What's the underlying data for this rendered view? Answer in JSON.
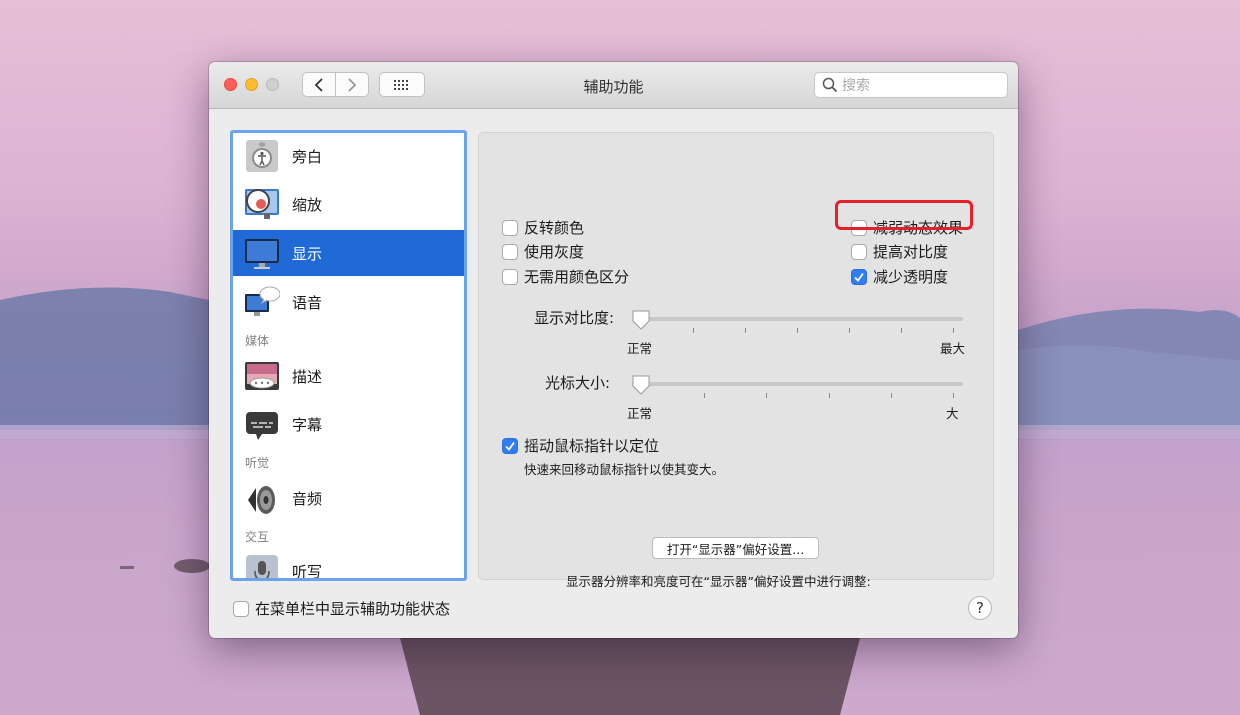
{
  "window": {
    "title": "辅助功能"
  },
  "search": {
    "placeholder": "搜索"
  },
  "sidebar": {
    "items": [
      {
        "label": "旁白",
        "icon": "voiceover-icon"
      },
      {
        "label": "缩放",
        "icon": "zoom-icon"
      },
      {
        "label": "显示",
        "icon": "display-icon",
        "selected": true
      },
      {
        "label": "语音",
        "icon": "speech-icon"
      },
      {
        "label": "描述",
        "icon": "descriptions-icon"
      },
      {
        "label": "字幕",
        "icon": "captions-icon"
      },
      {
        "label": "音频",
        "icon": "audio-icon"
      },
      {
        "label": "听写",
        "icon": "dictation-icon"
      }
    ],
    "sections": {
      "media": "媒体",
      "hearing": "听觉",
      "interaction": "交互"
    }
  },
  "display": {
    "invert_colors": {
      "label": "反转颜色",
      "checked": false
    },
    "grayscale": {
      "label": "使用灰度",
      "checked": false
    },
    "differentiate_without_color": {
      "label": "无需用颜色区分",
      "checked": false
    },
    "reduce_motion": {
      "label": "减弱动态效果",
      "checked": false
    },
    "increase_contrast": {
      "label": "提高对比度",
      "checked": false
    },
    "reduce_transparency": {
      "label": "减少透明度",
      "checked": true
    },
    "contrast_slider": {
      "label": "显示对比度:",
      "min_label": "正常",
      "max_label": "最大",
      "value": 0
    },
    "cursor_slider": {
      "label": "光标大小:",
      "min_label": "正常",
      "max_label": "大",
      "value": 0
    },
    "shake_to_locate": {
      "label": "摇动鼠标指针以定位",
      "checked": true,
      "description": "快速来回移动鼠标指针以使其变大。"
    },
    "display_note": "显示器分辨率和亮度可在“显示器”偏好设置中进行调整:",
    "open_display_button": "打开“显示器”偏好设置..."
  },
  "footer": {
    "menu_bar_status": {
      "label": "在菜单栏中显示辅助功能状态",
      "checked": false
    },
    "help": "?"
  },
  "colors": {
    "accent": "#1f6ad6",
    "highlight_box": "#e6202a"
  }
}
